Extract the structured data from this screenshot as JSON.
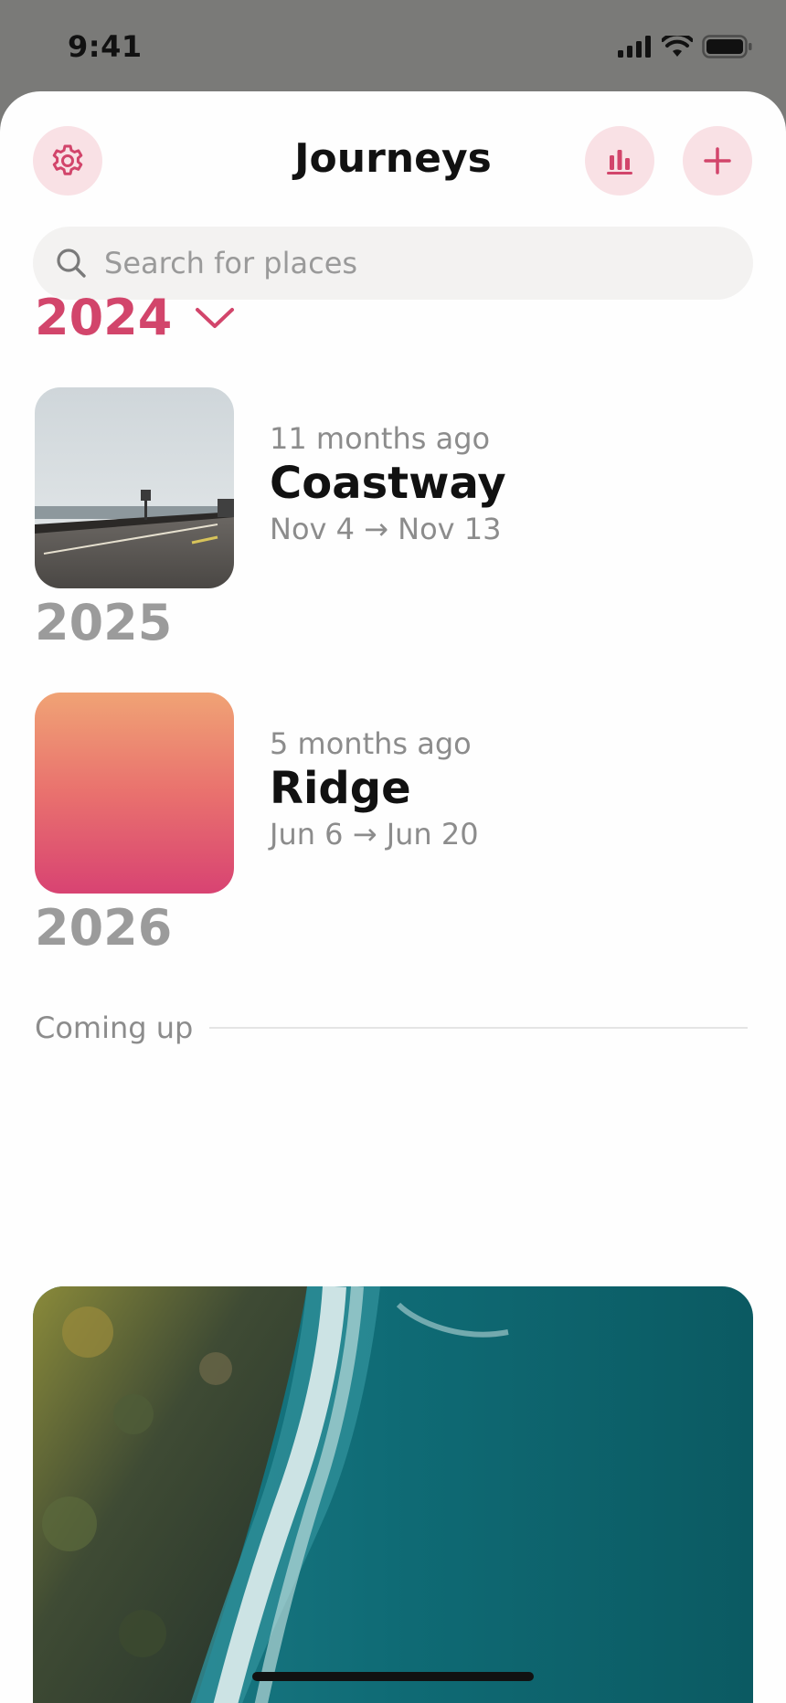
{
  "status_bar": {
    "time": "9:41"
  },
  "header": {
    "title": "Journeys"
  },
  "search": {
    "placeholder": "Search for places",
    "value": ""
  },
  "years": {
    "y2024": "2024",
    "y2025": "2025",
    "y2026": "2026"
  },
  "journeys": [
    {
      "ago": "11 months ago",
      "name": "Coastway",
      "dates": "Nov 4 → Nov 13"
    },
    {
      "ago": "5 months ago",
      "name": "Ridge",
      "dates": "Jun 6 → Jun 20"
    }
  ],
  "coming_up": {
    "label": "Coming up"
  },
  "colors": {
    "accent": "#d2456b",
    "accent_bg": "#f9e1e5",
    "muted_text": "#8c8c8c",
    "year_inactive": "#9b9b9b"
  },
  "icons": {
    "settings": "gear-icon",
    "stats": "bar-chart-icon",
    "add": "plus-icon",
    "search": "search-icon",
    "year_toggle": "chevron-down-icon"
  }
}
